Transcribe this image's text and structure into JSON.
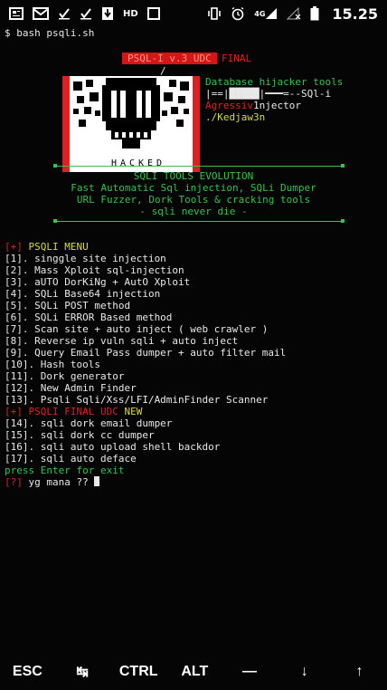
{
  "status_bar": {
    "hd_label": "HD",
    "network_label": "4G",
    "time": "15.25"
  },
  "terminal": {
    "command": "$ bash psqli.sh",
    "banner_title": "PSQL-I v.3 UDC",
    "banner_final": "FINAL",
    "banner_slash": "/",
    "logo_caption": "HACKED",
    "side_line1": "Database hijacker tools",
    "side_line2": "|==|█████|━━━=--SQl-i",
    "side_line3_a": "Agressiv",
    "side_line3_b": "1njector",
    "side_line4": "./Kedjaw3n",
    "evo_title": "SQLI TOOLS EVOLUTION",
    "evo_line1": "Fast Automatic Sql injection, SQLi Dumper",
    "evo_line2": "URL Fuzzer, Dork Tools & cracking tools",
    "evo_line3": "- sqli never die -",
    "menu_head_mark": "[+]",
    "menu_head_label": "PSQLI MENU",
    "menu_items": [
      "[1]. singgle site injection",
      "[2]. Mass Xploit sql-injection",
      "[3]. aUTO DorKiNg + AutO Xploit",
      "[4]. SQLi Base64 injection",
      "[5]. SQLi POST method",
      "[6]. SQLi ERROR Based method",
      "[7]. Scan site + auto inject ( web crawler )",
      "[8]. Reverse ip vuln sqli + auto inject",
      "[9]. Query Email Pass dumper + auto filter mail",
      "[10]. Hash tools",
      "[11]. Dork generator",
      "[12]. New Admin Finder",
      "[13]. Psqli Sqli/Xss/LFI/AdminFinder Scanner"
    ],
    "final_head_mark": "[+]",
    "final_head_red": "PSQLI FINAL UDC",
    "final_head_new": "NEW",
    "final_items": [
      "[14]. sqli dork email dumper",
      "[15]. sqli dork cc dumper",
      "[16]. sqli auto upload shell backdor",
      "[17]. sqli auto deface"
    ],
    "exit_hint": "press Enter for exit",
    "prompt_mark": "[?]",
    "prompt_text": "yg mana ?? "
  },
  "extra_keys": {
    "esc": "ESC",
    "tab": "↹",
    "ctrl": "CTRL",
    "alt": "ALT",
    "dash": "—",
    "down": "↓",
    "up": "↑"
  },
  "colors": {
    "background": "#050505",
    "green": "#39c24a",
    "yellow": "#d8d84a",
    "red": "#e02020",
    "text": "#e8e8e8"
  }
}
